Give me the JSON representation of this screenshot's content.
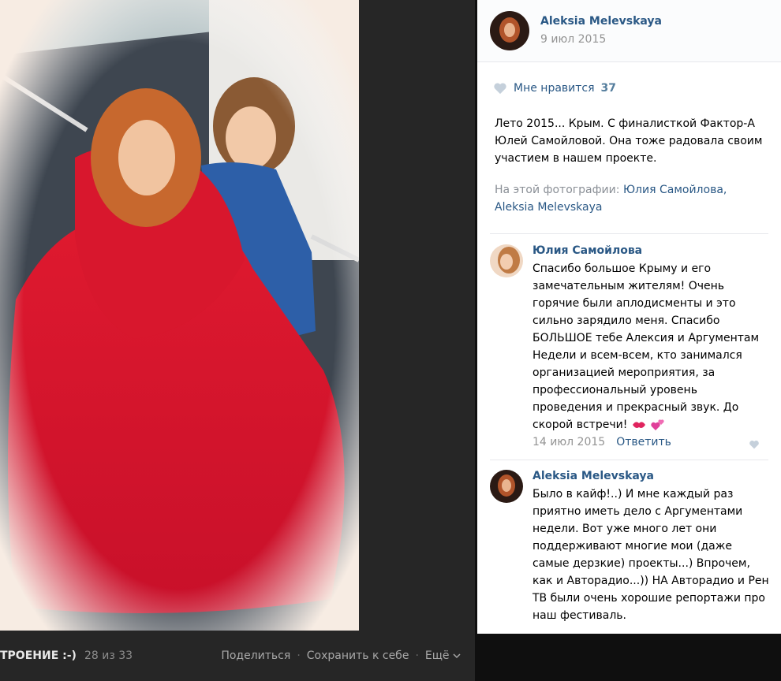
{
  "viewer": {
    "album_title": "ТРОЕНИЕ :-)",
    "counter": "28 из 33",
    "actions": {
      "share": "Поделиться",
      "save": "Сохранить к себе",
      "more": "Ещё"
    }
  },
  "post": {
    "author": "Aleksia Melevskaya",
    "date": "9 июл 2015",
    "like_label": "Мне нравится",
    "like_count": "37",
    "description": "Лето 2015... Крым. С финалисткой Фактор-А Юлей Самойловой. Она тоже радовала своим участием в нашем проекте.",
    "tagged_label": "На этой фотографии:",
    "tagged": [
      "Юлия Самойлова,",
      "Aleksia Melevskaya"
    ]
  },
  "comments": [
    {
      "author": "Юлия Самойлова",
      "text": "Спасибо большое Крыму и его замечательным жителям! Очень горячие были аплодисменты и это сильно зарядило меня. Спасибо БОЛЬШОЕ тебе Алексия и Аргументам Недели и всем-всем, кто занимался организацией мероприятия, за профессиональный уровень проведения и прекрасный звук. До скорой встречи!",
      "date": "14 июл 2015",
      "reply": "Ответить"
    },
    {
      "author": "Aleksia Melevskaya",
      "text": "Было в кайф!..) И мне каждый раз приятно иметь дело с Аргументами недели. Вот уже много лет они поддерживают многие мои (даже самые дерзкие) проекты...) Впрочем, как и Авторадио...)) НА Авторадио и Рен ТВ были очень хорошие репортажи про наш фестиваль."
    }
  ],
  "icons": [
    "heart-icon",
    "chevron-down-icon",
    "kiss-icon",
    "hearts-icon"
  ],
  "colors": {
    "link": "#2a5885",
    "viewer_bg": "#262626",
    "panel_bg": "#ffffff",
    "dress": "#e8192c"
  }
}
